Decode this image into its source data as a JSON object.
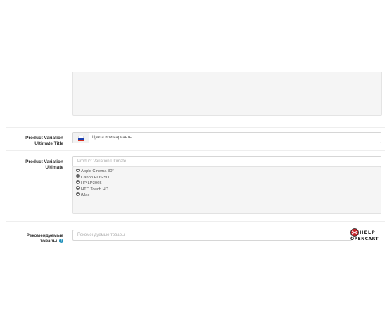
{
  "form": {
    "variation_title": {
      "label_line1": "Product Variation",
      "label_line2": "Ultimate Title",
      "value": "Цвета или варианты"
    },
    "variation_ultimate": {
      "label_line1": "Product Variation",
      "label_line2": "Ultimate",
      "placeholder": "Product Variation Ultimate",
      "items": [
        "Apple Cinema 30\"",
        "Canon EOS 5D",
        "HP LP3065",
        "HTC Touch HD",
        "iMac"
      ]
    },
    "recommended": {
      "label_line1": "Рекомендуемые",
      "label_line2": "товары",
      "placeholder": "Рекомендуемые товары"
    }
  },
  "watermark": {
    "line1": "HELP",
    "line2": "OPENCART"
  },
  "colors": {
    "help_icon": "#1f90bb",
    "flag_white": "#ffffff",
    "flag_blue": "#1c3fb0",
    "flag_red": "#d52b1e"
  },
  "icons": {
    "item_remove": "minus-circle-icon",
    "help": "question-circle-icon",
    "language": "russian-flag-icon"
  }
}
